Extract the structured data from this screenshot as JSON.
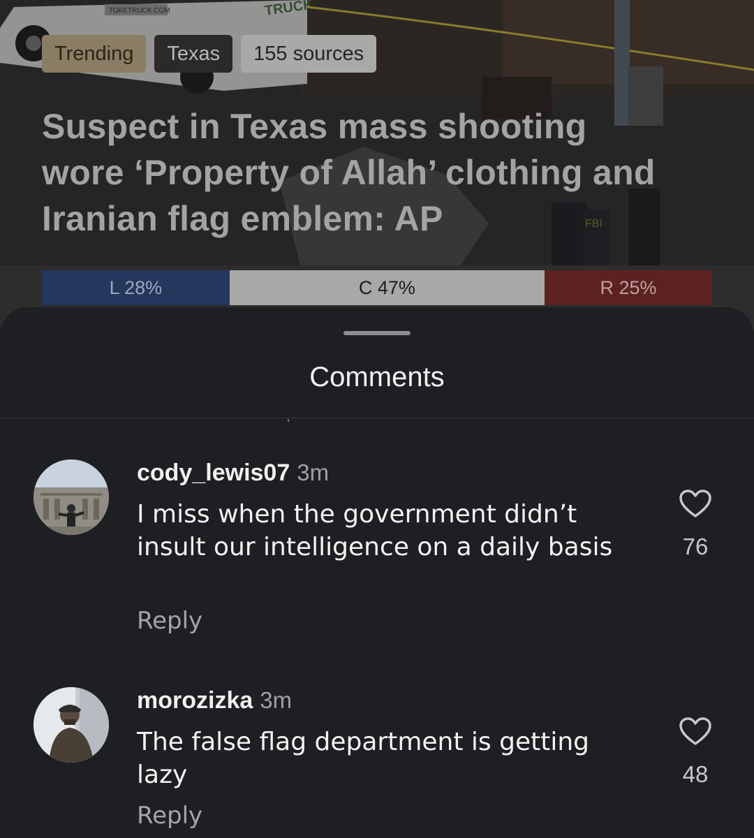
{
  "article": {
    "tags": [
      "Trending",
      "Texas",
      "155 sources"
    ],
    "headline": "Suspect in Texas mass shooting wore ‘Property of Allah’ clothing and Iranian flag emblem: AP",
    "bias": {
      "left_label": "L 28%",
      "left_share": 0.28,
      "center_label": "C 47%",
      "center_share": 0.47,
      "right_label": "R 25%",
      "right_share": 0.25,
      "colors": {
        "left": "#24375d",
        "center": "#a8a8a8",
        "right": "#5c2222"
      }
    },
    "photo_text": {
      "van": "TRUCK",
      "van_url": "TOKETRUCK.COM",
      "vest": "FBI"
    }
  },
  "comments_sheet": {
    "title": "Comments",
    "comments": [
      {
        "username": "cody_lewis07",
        "time": "3m",
        "text": "I miss when the government didn’t insult our intelligence on a daily basis",
        "reply_label": "Reply",
        "likes": "76",
        "like_icon": "heart-outline-icon"
      },
      {
        "username": "morozizka",
        "time": "3m",
        "text": "The false flag department is getting lazy",
        "reply_label": "Reply",
        "likes": "48",
        "like_icon": "heart-outline-icon"
      }
    ]
  }
}
